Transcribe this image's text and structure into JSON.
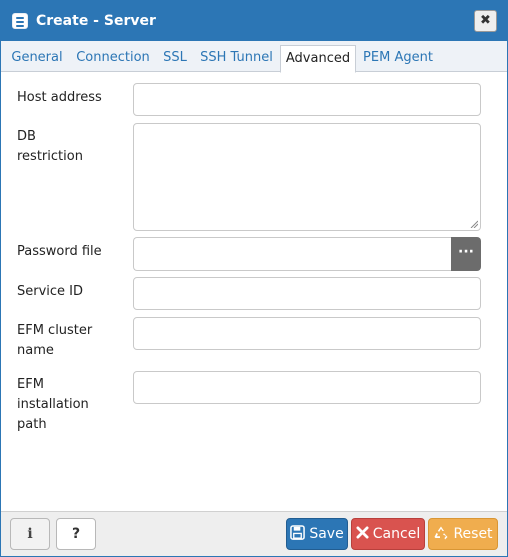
{
  "window": {
    "title": "Create - Server",
    "close_label": "✖"
  },
  "tabs": [
    {
      "label": "General",
      "active": false
    },
    {
      "label": "Connection",
      "active": false
    },
    {
      "label": "SSL",
      "active": false
    },
    {
      "label": "SSH Tunnel",
      "active": false
    },
    {
      "label": "Advanced",
      "active": true
    },
    {
      "label": "PEM Agent",
      "active": false
    }
  ],
  "form": {
    "host_address": {
      "label": "Host address",
      "value": ""
    },
    "db_restriction": {
      "label_line1": "DB",
      "label_line2": "restriction",
      "value": ""
    },
    "password_file": {
      "label": "Password file",
      "value": "",
      "browse_label": "···"
    },
    "service_id": {
      "label": "Service ID",
      "value": ""
    },
    "efm_cluster_name": {
      "label_line1": "EFM cluster",
      "label_line2": "name",
      "value": ""
    },
    "efm_installation_path": {
      "label_line1": "EFM",
      "label_line2": "installation",
      "label_line3": "path",
      "value": ""
    }
  },
  "footer": {
    "info_label": "i",
    "help_label": "?",
    "save_label": "Save",
    "cancel_label": "Cancel",
    "reset_label": "Reset"
  },
  "colors": {
    "primary": "#2c76b5",
    "danger": "#d9534f",
    "warning": "#f0ad4e",
    "browse_button": "#6c6c6c"
  },
  "icons": {
    "title": "server-icon",
    "close": "close-icon",
    "browse": "ellipsis-icon",
    "save": "floppy-disk-icon",
    "cancel": "x-icon",
    "reset": "recycle-icon"
  }
}
